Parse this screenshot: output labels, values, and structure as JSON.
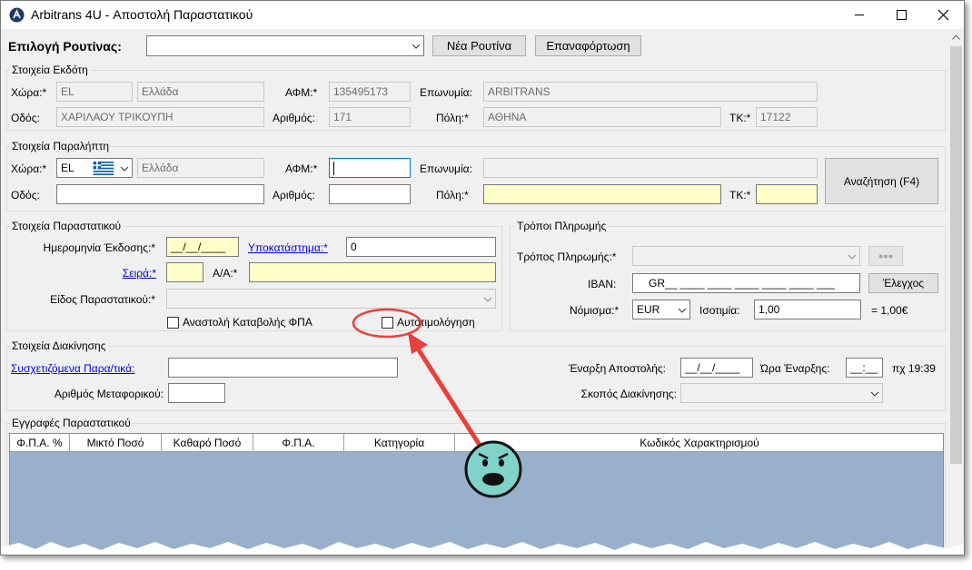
{
  "window": {
    "title": "Arbitrans 4U - Αποστολή Παραστατικού"
  },
  "toolbar": {
    "routine_label": "Επιλογή Ρουτίνας:",
    "routine_value": "",
    "new_routine": "Νέα Ρουτίνα",
    "reload": "Επαναφόρτωση"
  },
  "issuer": {
    "title": "Στοιχεία Εκδότη",
    "country_label": "Χώρα:*",
    "country_code": "EL",
    "country_name": "Ελλάδα",
    "afm_label": "ΑΦΜ:*",
    "afm": "135495173",
    "name_label": "Επωνυμία:",
    "name": "ARBITRANS",
    "street_label": "Οδός:",
    "street": "ΧΑΡΙΛΑΟΥ ΤΡΙΚΟΥΠΗ",
    "number_label": "Αριθμός:",
    "number": "171",
    "city_label": "Πόλη:*",
    "city": "ΑΘΗΝΑ",
    "zip_label": "ΤΚ:*",
    "zip": "17122"
  },
  "recipient": {
    "title": "Στοιχεία Παραλήπτη",
    "country_label": "Χώρα:*",
    "country_code": "EL",
    "country_name": "Ελλάδα",
    "afm_label": "ΑΦΜ:*",
    "afm": "",
    "name_label": "Επωνυμία:",
    "name": "",
    "street_label": "Οδός:",
    "street": "",
    "number_label": "Αριθμός:",
    "number": "",
    "city_label": "Πόλη:*",
    "city": "",
    "zip_label": "ΤΚ:*",
    "zip": "",
    "search_button": "Αναζήτηση (F4)"
  },
  "document": {
    "title": "Στοιχεία Παραστατικού",
    "issue_date_label": "Ημερομηνία Έκδοσης:*",
    "issue_date": "__/__/____",
    "branch_label": "Υποκατάστημα:*",
    "branch": "0",
    "series_label": "Σειρά:*",
    "series": "",
    "aa_label": "Α/Α:*",
    "aa": "",
    "type_label": "Είδος Παραστατικού:*",
    "type": "",
    "vat_suspend_label": "Αναστολή Καταβολής ΦΠΑ",
    "self_billing_label": "Αυτοτιμολόγηση"
  },
  "payment": {
    "title": "Τρόποι Πληρωμής",
    "method_label": "Τρόπος Πληρωμής:*",
    "method": "",
    "more_button": "●●●",
    "iban_label": "IBAN:",
    "iban": "GR__ ____ ____ ____ ____ ____ ___",
    "check_button": "Έλεγχος",
    "currency_label": "Νόμισμα:*",
    "currency": "EUR",
    "rate_label": "Ισοτιμία:",
    "rate": "1,00",
    "rate_display": "= 1,00€"
  },
  "shipment": {
    "title": "Στοιχεία Διακίνησης",
    "related_label": "Συσχετιζόμενα Παρα/τικά:",
    "related": "",
    "vehicle_label": "Αριθμός Μεταφορικού:",
    "vehicle": "",
    "start_date_label": "Έναρξη Αποστολής:",
    "start_date": "__/__/____",
    "start_time_label": "Ώρα Έναρξης:",
    "start_time": "__:__",
    "time_hint": "πχ 19:39",
    "purpose_label": "Σκοπός Διακίνησης:",
    "purpose": ""
  },
  "entries": {
    "title": "Εγγραφές Παραστατικού",
    "columns": [
      "Φ.Π.Α. %",
      "Μικτό Ποσό",
      "Καθαρό Ποσό",
      "Φ.Π.Α.",
      "Κατηγορία",
      "Κωδικός Χαρακτηρισμού"
    ]
  },
  "colors": {
    "grid_bg": "#98b0cc",
    "highlight": "#e8403a",
    "accent_link": "#0000e0",
    "required_field": "#ffffc8",
    "face": "#7fd3c8"
  }
}
